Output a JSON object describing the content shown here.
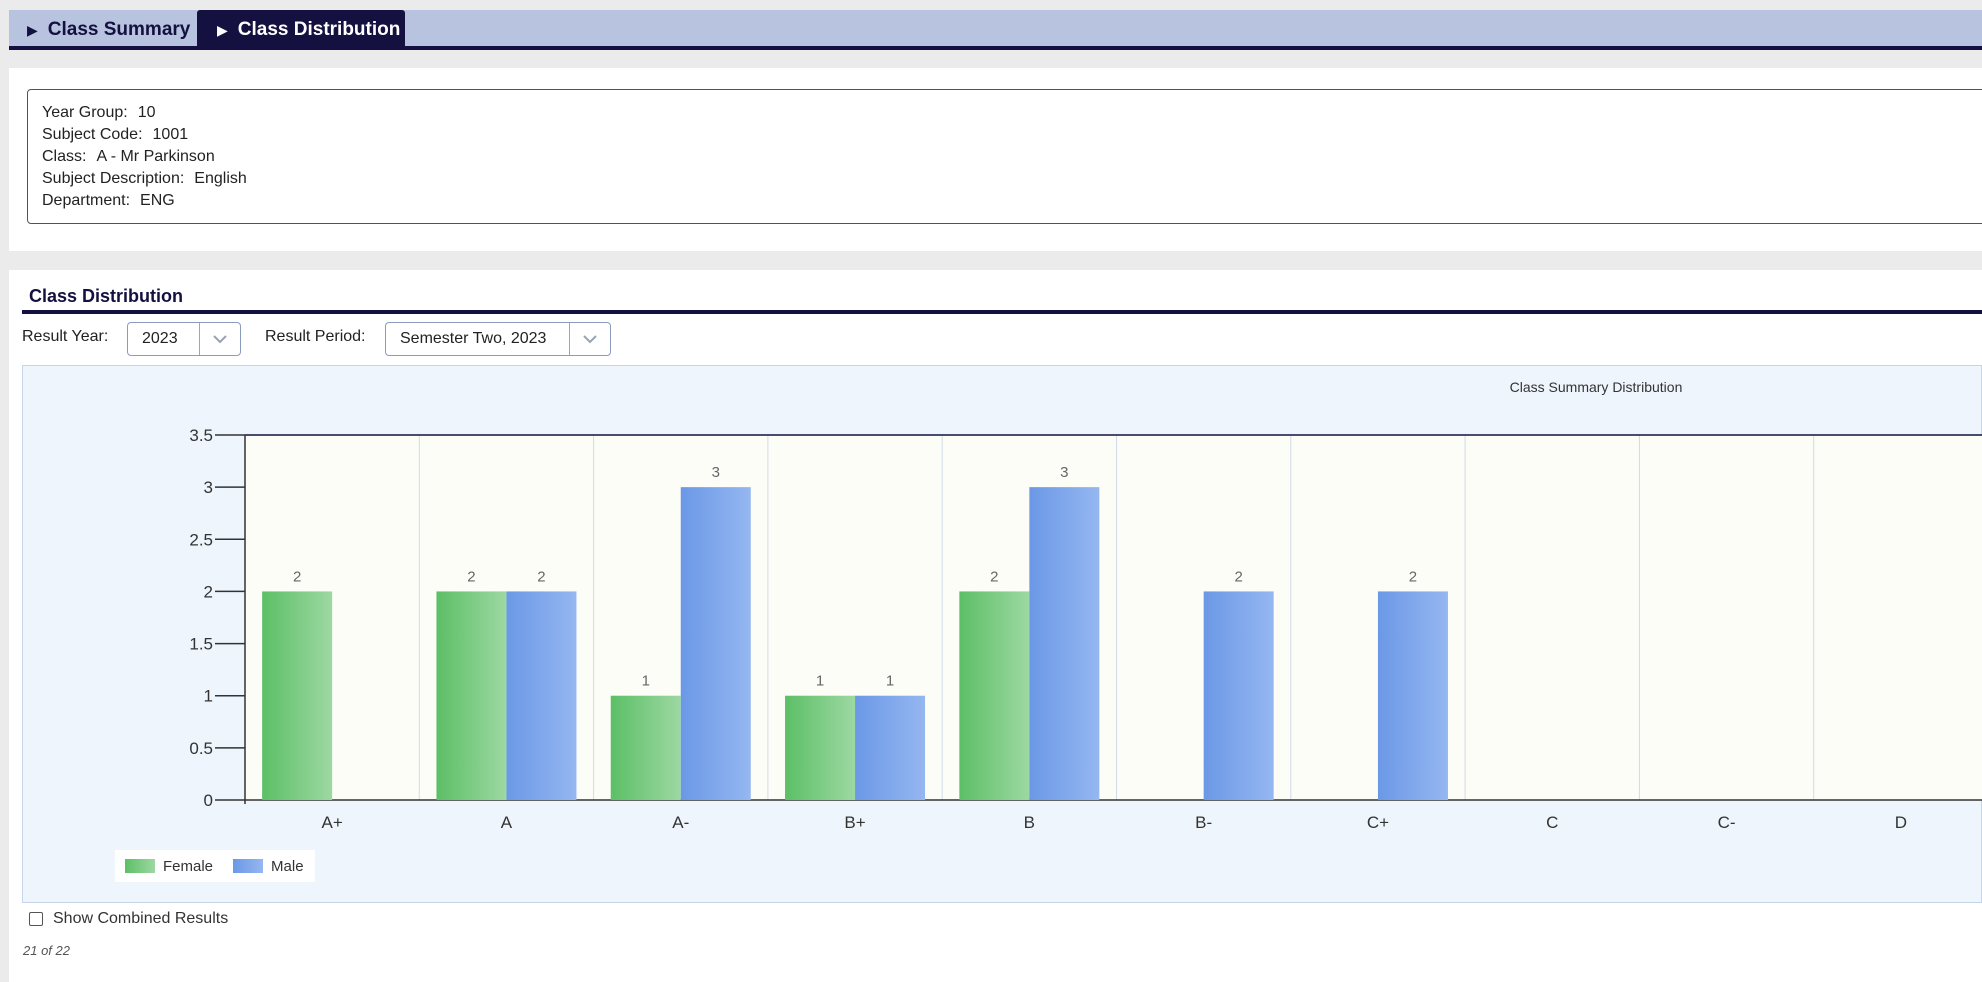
{
  "tabs": [
    {
      "label": "Class Summary"
    },
    {
      "label": "Class Distribution"
    }
  ],
  "info": {
    "rows": [
      {
        "label": "Year Group:",
        "value": "10"
      },
      {
        "label": "Subject Code:",
        "value": "1001"
      },
      {
        "label": "Class:",
        "value": "A - Mr Parkinson"
      },
      {
        "label": "Subject Description:",
        "value": "English"
      },
      {
        "label": "Department:",
        "value": "ENG"
      }
    ]
  },
  "section": {
    "title": "Class Distribution",
    "result_year_label": "Result Year:",
    "result_year_value": "2023",
    "result_period_label": "Result Period:",
    "result_period_value": "Semester Two, 2023"
  },
  "colors": {
    "female": "#5cbf66",
    "male": "#6b98e6",
    "header": "#14103f"
  },
  "chart_data": {
    "type": "bar",
    "title": "Class Summary Distribution",
    "categories": [
      "A+",
      "A",
      "A-",
      "B+",
      "B",
      "B-",
      "C+",
      "C",
      "C-",
      "D"
    ],
    "series": [
      {
        "name": "Female",
        "values": [
          2,
          2,
          1,
          1,
          2,
          0,
          0,
          0,
          0,
          0
        ]
      },
      {
        "name": "Male",
        "values": [
          0,
          2,
          3,
          1,
          3,
          2,
          2,
          0,
          0,
          0
        ]
      }
    ],
    "ylim": [
      0,
      3.5
    ],
    "yticks": [
      "0",
      "0.5",
      "1",
      "1.5",
      "2",
      "2.5",
      "3",
      "3.5"
    ],
    "legend": "bottom-left",
    "grid": "vertical"
  },
  "footer": {
    "combined_label": "Show Combined Results",
    "pager": "21 of 22"
  }
}
